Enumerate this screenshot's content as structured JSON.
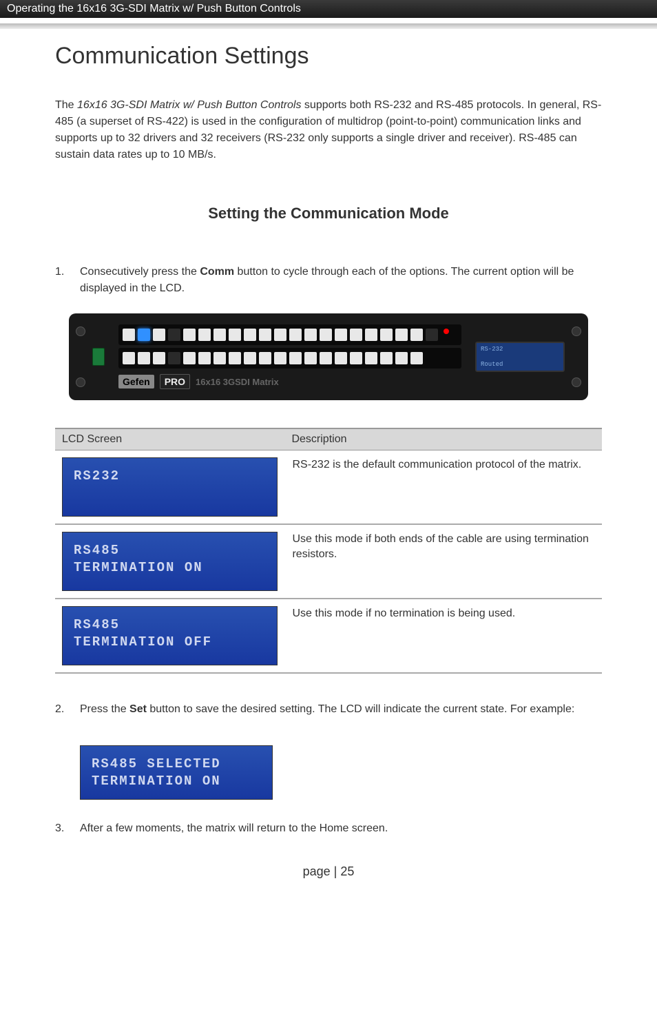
{
  "header": {
    "banner": "Operating the 16x16 3G-SDI Matrix w/ Push Button Controls"
  },
  "title": "Communication Settings",
  "intro": {
    "prefix": "The ",
    "italic": "16x16 3G-SDI Matrix w/ Push Button Controls",
    "rest": " supports both RS-232 and RS-485 protocols.  In general, RS-485 (a superset of RS-422) is used in the configuration of multidrop (point-to-point) communication links and supports up to 32 drivers and 32 receivers (RS-232 only supports a single driver and receiver).  RS-485 can sustain data rates up to 10 MB/s."
  },
  "subheading": "Setting the Communication Mode",
  "step1": {
    "num": "1.",
    "pre": "Consecutively press the ",
    "bold": "Comm",
    "post": " button to cycle through each of the options.  The current option will be displayed in the LCD."
  },
  "device": {
    "brand_gefen": "Gefen",
    "brand_pro": "PRO",
    "brand_sub": "16x16 3GSDI Matrix",
    "lcd_top": "RS-232",
    "lcd_bottom": "Routed"
  },
  "table": {
    "headers": {
      "lcd": "LCD Screen",
      "desc": "Description"
    },
    "rows": [
      {
        "lcd": "RS232",
        "desc": "RS-232 is the default communication protocol of the matrix."
      },
      {
        "lcd": "RS485\nTERMINATION ON",
        "desc": "Use this mode if both ends of the cable are using termination resistors."
      },
      {
        "lcd": "RS485\nTERMINATION OFF",
        "desc": "Use this mode if no termination is being used."
      }
    ]
  },
  "step2": {
    "num": "2.",
    "pre": "Press the ",
    "bold": "Set",
    "post": " button to save the desired setting.  The LCD will indicate the current state.  For example:"
  },
  "lcd_example": "RS485 SELECTED\nTERMINATION ON",
  "step3": {
    "num": "3.",
    "text": "After a few moments, the matrix will return to the Home screen."
  },
  "page_footer": "page | 25"
}
